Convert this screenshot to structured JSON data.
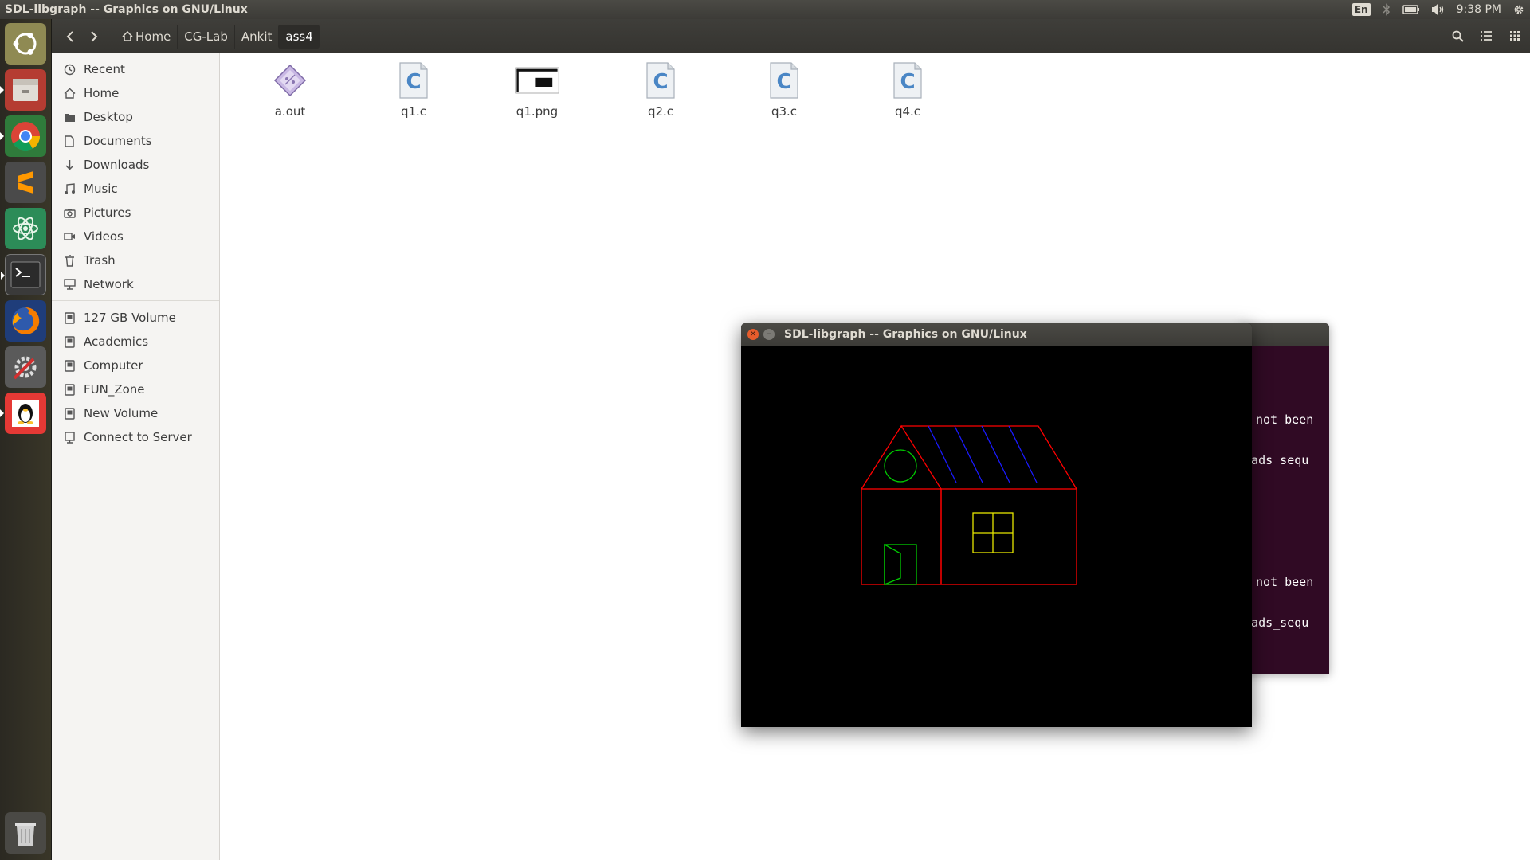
{
  "top_panel": {
    "window_title": "SDL-libgraph -- Graphics on GNU/Linux",
    "keyboard_layout": "En",
    "clock": "9:38 PM",
    "icons": [
      "bluetooth-icon",
      "battery-icon",
      "volume-icon",
      "settings-gear-icon"
    ]
  },
  "launcher": {
    "items": [
      {
        "name": "ubuntu-dash-icon"
      },
      {
        "name": "files-icon",
        "running": true
      },
      {
        "name": "chrome-icon",
        "running": true
      },
      {
        "name": "sublime-text-icon"
      },
      {
        "name": "atom-icon"
      },
      {
        "name": "terminal-icon",
        "running": true
      },
      {
        "name": "firefox-icon"
      },
      {
        "name": "system-settings-icon"
      },
      {
        "name": "sdl-libgraph-icon",
        "running": true
      }
    ],
    "trash": "trash-icon"
  },
  "header": {
    "breadcrumb": [
      {
        "label": "Home",
        "icon": "home-icon"
      },
      {
        "label": "CG-Lab"
      },
      {
        "label": "Ankit"
      },
      {
        "label": "ass4",
        "active": true
      }
    ]
  },
  "sidebar": {
    "places": [
      {
        "label": "Recent",
        "icon": "clock-icon"
      },
      {
        "label": "Home",
        "icon": "home-icon"
      },
      {
        "label": "Desktop",
        "icon": "folder-icon"
      },
      {
        "label": "Documents",
        "icon": "document-icon"
      },
      {
        "label": "Downloads",
        "icon": "download-icon"
      },
      {
        "label": "Music",
        "icon": "music-icon"
      },
      {
        "label": "Pictures",
        "icon": "camera-icon"
      },
      {
        "label": "Videos",
        "icon": "video-icon"
      },
      {
        "label": "Trash",
        "icon": "trash-icon"
      },
      {
        "label": "Network",
        "icon": "network-icon"
      }
    ],
    "devices": [
      {
        "label": "127 GB Volume",
        "icon": "drive-icon"
      },
      {
        "label": "Academics",
        "icon": "drive-icon"
      },
      {
        "label": "Computer",
        "icon": "drive-icon"
      },
      {
        "label": "FUN_Zone",
        "icon": "drive-icon"
      },
      {
        "label": "New Volume",
        "icon": "drive-icon"
      },
      {
        "label": "Connect to Server",
        "icon": "server-icon"
      }
    ]
  },
  "files": [
    {
      "name": "a.out",
      "type": "executable"
    },
    {
      "name": "q1.c",
      "type": "c-source"
    },
    {
      "name": "q1.png",
      "type": "image"
    },
    {
      "name": "q2.c",
      "type": "c-source"
    },
    {
      "name": "q3.c",
      "type": "c-source"
    },
    {
      "name": "q4.c",
      "type": "c-source"
    }
  ],
  "terminal": {
    "lines": [
      "not been",
      "reads_sequ",
      "not been",
      "reads_sequ"
    ]
  },
  "sdl_window": {
    "title": "SDL-libgraph -- Graphics on GNU/Linux"
  },
  "colors": {
    "house_outline": "#ff0000",
    "roof_stripes": "#0000ff",
    "circle_and_door": "#00cc00",
    "window": "#e6e600"
  }
}
